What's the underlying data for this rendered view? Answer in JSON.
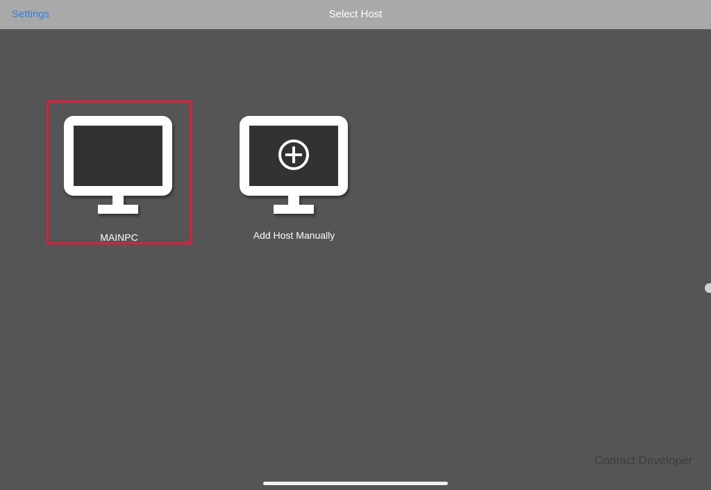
{
  "navbar": {
    "settings_label": "Settings",
    "title": "Select Host"
  },
  "hosts": [
    {
      "label": "MAINPC",
      "selected": true,
      "icon": "monitor-icon"
    },
    {
      "label": "Add Host Manually",
      "selected": false,
      "icon": "monitor-add-icon"
    }
  ],
  "footer": {
    "contact_label": "Contact Developer"
  },
  "colors": {
    "background": "#555555",
    "navbar": "#a9a9a9",
    "link": "#2f7fe0",
    "selection": "#d8213a",
    "monitor": "#ffffff",
    "screen": "#333333"
  }
}
